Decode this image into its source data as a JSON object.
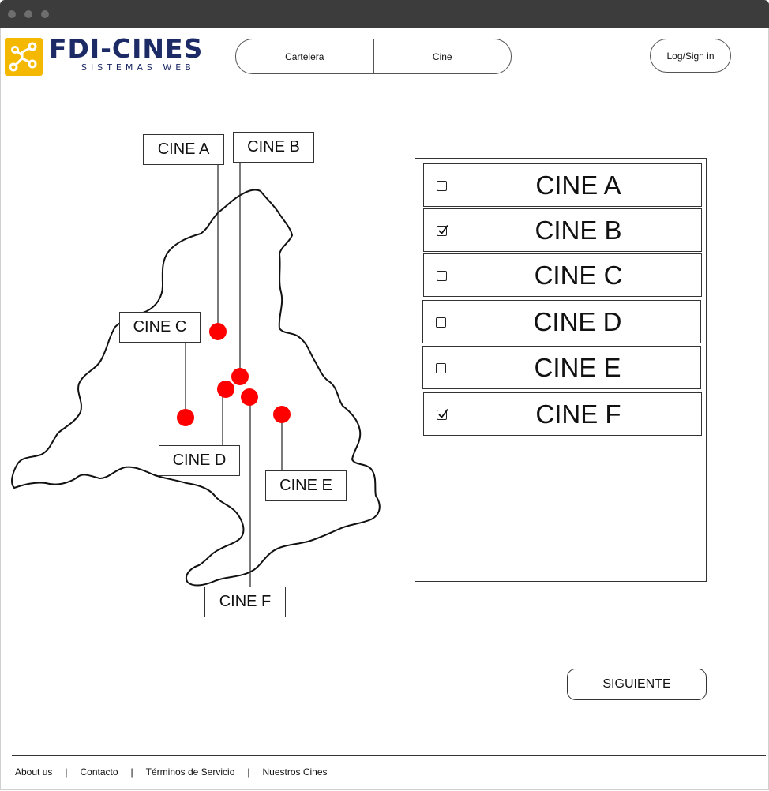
{
  "brand": {
    "name": "FDI-CINES",
    "tagline": "SISTEMAS WEB",
    "colors": {
      "primary": "#1c2a66",
      "accent": "#f5b800"
    }
  },
  "nav": {
    "tabs": [
      {
        "label": "Cartelera"
      },
      {
        "label": "Cine"
      }
    ],
    "login_label": "Log/Sign in"
  },
  "map": {
    "marker_color": "#ff0000",
    "labels": [
      "CINE A",
      "CINE B",
      "CINE C",
      "CINE D",
      "CINE E",
      "CINE F"
    ]
  },
  "cine_list": [
    {
      "label": "CINE A",
      "checked": false
    },
    {
      "label": "CINE B",
      "checked": true
    },
    {
      "label": "CINE C",
      "checked": false
    },
    {
      "label": "CINE D",
      "checked": false
    },
    {
      "label": "CINE E",
      "checked": false
    },
    {
      "label": "CINE F",
      "checked": true
    }
  ],
  "next_label": "SIGUIENTE",
  "footer": {
    "links": [
      "About us",
      "Contacto",
      "Términos de Servicio",
      "Nuestros Cines"
    ],
    "separator": "|"
  }
}
